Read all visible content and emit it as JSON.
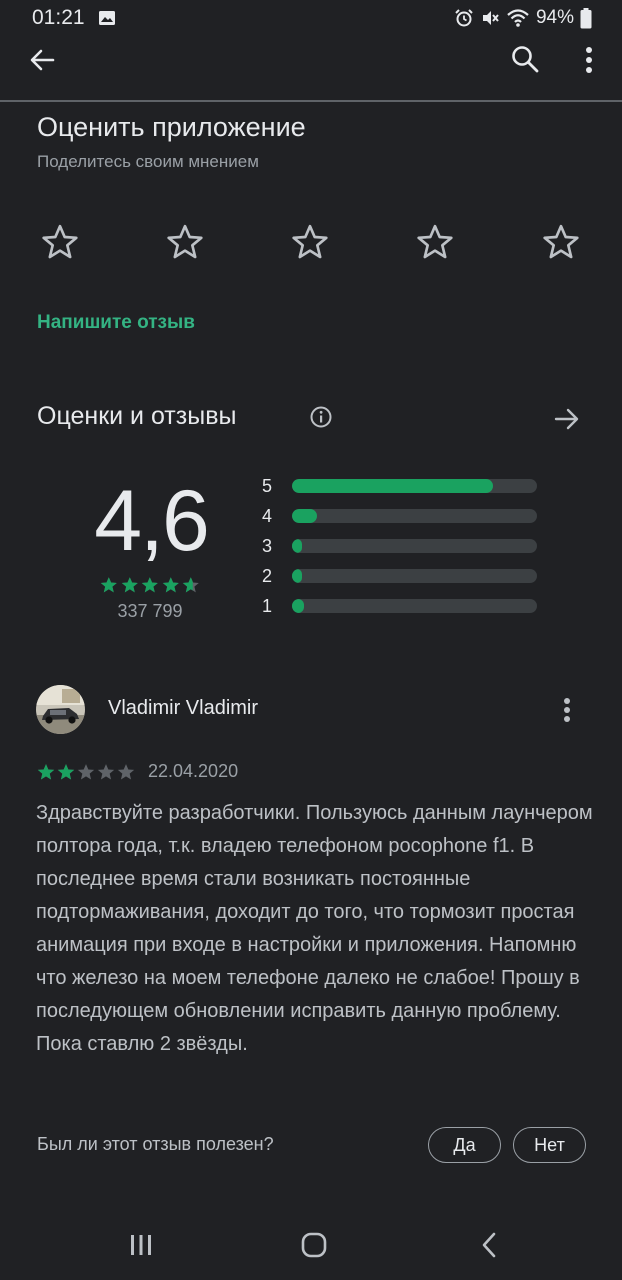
{
  "status_bar": {
    "time": "01:21",
    "battery": "94%",
    "icons": [
      "gallery-icon",
      "alarm-icon",
      "mute-icon",
      "wifi-icon",
      "battery-icon"
    ]
  },
  "app_bar": {
    "icons": [
      "back-arrow-icon",
      "search-icon",
      "more-vert-icon"
    ]
  },
  "rate_app": {
    "title": "Оценить приложение",
    "subtitle": "Поделитесь своим мнением",
    "star_count": 5,
    "write_review": "Напишите отзыв"
  },
  "ratings": {
    "title": "Оценки и отзывы",
    "average": "4,6",
    "average_stars": 4.6,
    "count": "337 799",
    "distribution": [
      {
        "label": "5",
        "fraction": 0.82
      },
      {
        "label": "4",
        "fraction": 0.1
      },
      {
        "label": "3",
        "fraction": 0.04
      },
      {
        "label": "2",
        "fraction": 0.04
      },
      {
        "label": "1",
        "fraction": 0.05
      }
    ]
  },
  "review": {
    "author": "Vladimir Vladimir",
    "stars": 2,
    "date": "22.04.2020",
    "text": "Здравствуйте разработчики. Пользуюсь данным лаунчером полтора года, т.к. владею телефоном pocophone f1. В последнее время стали возникать постоянные подтормаживания, доходит до того, что тормозит простая анимация при входе в настройки и приложения. Напомню что железо на моем телефоне далеко не слабое! Прошу в последующем обновлении исправить данную проблему. Пока ставлю 2 звёзды.",
    "helpful_question": "Был ли этот отзыв полезен?",
    "yes_label": "Да",
    "no_label": "Нет"
  },
  "colors": {
    "background": "#202124",
    "accent_green": "#34b383",
    "bar_fill": "#1aa260",
    "bar_track": "#3c4043"
  }
}
